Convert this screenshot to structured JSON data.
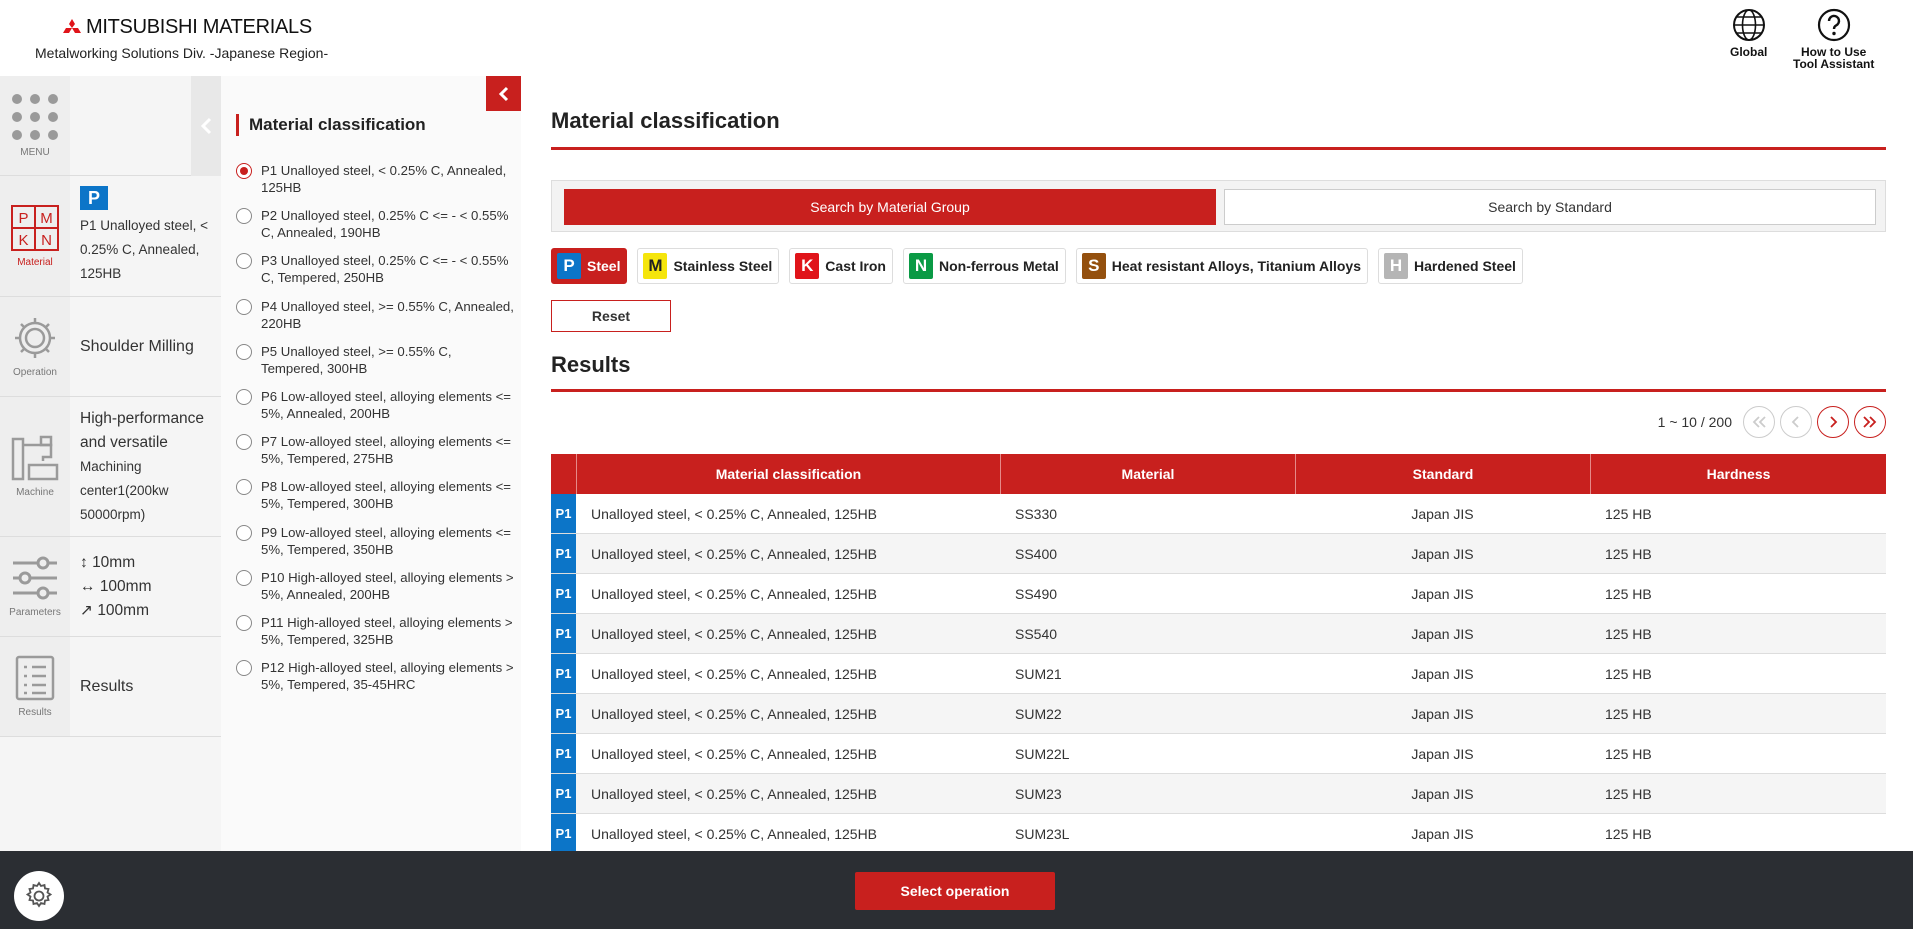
{
  "header": {
    "brand": "MITSUBISHI MATERIALS",
    "subtitle": "Metalworking Solutions Div. -Japanese Region-",
    "global_label": "Global",
    "howto_line1": "How to Use",
    "howto_line2": "Tool Assistant"
  },
  "nav": {
    "menu_label": "MENU",
    "material": {
      "icon_label": "Material",
      "badge": "P",
      "text": "P1 Unalloyed steel, < 0.25% C, Annealed, 125HB"
    },
    "operation": {
      "icon_label": "Operation",
      "text": "Shoulder Milling"
    },
    "machine": {
      "icon_label": "Machine",
      "title_line": "High-performance and versatile",
      "detail": "Machining center1(200kw 50000rpm)"
    },
    "parameters": {
      "icon_label": "Parameters",
      "p1": "10mm",
      "p2": "100mm",
      "p3": "100mm"
    },
    "results": {
      "icon_label": "Results",
      "text": "Results"
    }
  },
  "panel": {
    "title": "Material classification",
    "items": [
      {
        "label": "P1 Unalloyed steel, < 0.25% C, Annealed, 125HB",
        "checked": true
      },
      {
        "label": "P2 Unalloyed steel, 0.25% C <= - < 0.55% C, Annealed, 190HB",
        "checked": false
      },
      {
        "label": "P3 Unalloyed steel, 0.25% C <= - < 0.55% C, Tempered, 250HB",
        "checked": false
      },
      {
        "label": "P4 Unalloyed steel, >= 0.55% C, Annealed, 220HB",
        "checked": false
      },
      {
        "label": "P5 Unalloyed steel, >= 0.55% C, Tempered, 300HB",
        "checked": false
      },
      {
        "label": "P6 Low-alloyed steel, alloying elements <= 5%, Annealed, 200HB",
        "checked": false
      },
      {
        "label": "P7 Low-alloyed steel, alloying elements <= 5%, Tempered, 275HB",
        "checked": false
      },
      {
        "label": "P8 Low-alloyed steel, alloying elements <= 5%, Tempered, 300HB",
        "checked": false
      },
      {
        "label": "P9 Low-alloyed steel, alloying elements <= 5%, Tempered, 350HB",
        "checked": false
      },
      {
        "label": "P10 High-alloyed steel, alloying elements > 5%, Annealed, 200HB",
        "checked": false
      },
      {
        "label": "P11 High-alloyed steel, alloying elements > 5%, Tempered, 325HB",
        "checked": false
      },
      {
        "label": "P12 High-alloyed steel, alloying elements > 5%, Tempered, 35-45HRC",
        "checked": false
      }
    ]
  },
  "main": {
    "title": "Material classification",
    "search_group": "Search by Material Group",
    "search_standard": "Search by Standard",
    "groups": [
      {
        "badge": "P",
        "label": "Steel",
        "badge_bg": "#0c75c8",
        "badge_fg": "#ffffff",
        "active": true
      },
      {
        "badge": "M",
        "label": "Stainless Steel",
        "badge_bg": "#f5e50c",
        "badge_fg": "#222222",
        "active": false
      },
      {
        "badge": "K",
        "label": "Cast Iron",
        "badge_bg": "#e0141a",
        "badge_fg": "#ffffff",
        "active": false
      },
      {
        "badge": "N",
        "label": "Non-ferrous Metal",
        "badge_bg": "#0a9a45",
        "badge_fg": "#ffffff",
        "active": false
      },
      {
        "badge": "S",
        "label": "Heat resistant Alloys, Titanium Alloys",
        "badge_bg": "#94500e",
        "badge_fg": "#ffffff",
        "active": false
      },
      {
        "badge": "H",
        "label": "Hardened Steel",
        "badge_bg": "#b5b5b5",
        "badge_fg": "#ffffff",
        "active": false
      }
    ],
    "reset": "Reset",
    "results_title": "Results",
    "pager_count": "1 ~ 10 / 200",
    "columns": [
      "Material classification",
      "Material",
      "Standard",
      "Hardness"
    ],
    "rows": [
      {
        "tag": "P1",
        "classification": "Unalloyed steel, < 0.25% C, Annealed, 125HB",
        "material": "SS330",
        "standard": "Japan JIS",
        "hardness": "125 HB"
      },
      {
        "tag": "P1",
        "classification": "Unalloyed steel, < 0.25% C, Annealed, 125HB",
        "material": "SS400",
        "standard": "Japan JIS",
        "hardness": "125 HB"
      },
      {
        "tag": "P1",
        "classification": "Unalloyed steel, < 0.25% C, Annealed, 125HB",
        "material": "SS490",
        "standard": "Japan JIS",
        "hardness": "125 HB"
      },
      {
        "tag": "P1",
        "classification": "Unalloyed steel, < 0.25% C, Annealed, 125HB",
        "material": "SS540",
        "standard": "Japan JIS",
        "hardness": "125 HB"
      },
      {
        "tag": "P1",
        "classification": "Unalloyed steel, < 0.25% C, Annealed, 125HB",
        "material": "SUM21",
        "standard": "Japan JIS",
        "hardness": "125 HB"
      },
      {
        "tag": "P1",
        "classification": "Unalloyed steel, < 0.25% C, Annealed, 125HB",
        "material": "SUM22",
        "standard": "Japan JIS",
        "hardness": "125 HB"
      },
      {
        "tag": "P1",
        "classification": "Unalloyed steel, < 0.25% C, Annealed, 125HB",
        "material": "SUM22L",
        "standard": "Japan JIS",
        "hardness": "125 HB"
      },
      {
        "tag": "P1",
        "classification": "Unalloyed steel, < 0.25% C, Annealed, 125HB",
        "material": "SUM23",
        "standard": "Japan JIS",
        "hardness": "125 HB"
      },
      {
        "tag": "P1",
        "classification": "Unalloyed steel, < 0.25% C, Annealed, 125HB",
        "material": "SUM23L",
        "standard": "Japan JIS",
        "hardness": "125 HB"
      }
    ]
  },
  "footer": {
    "select_operation": "Select operation"
  },
  "colors": {
    "accent": "#c8201e",
    "steel_tag": "#0c75c8",
    "footer_bg": "#2b2e33"
  },
  "icons": {
    "logo": "three-diamonds-icon",
    "global": "globe-icon",
    "help": "question-circle-icon",
    "menu": "grid-dots-icon",
    "operation": "gear-icon",
    "machine": "machine-icon",
    "parameters": "sliders-icon",
    "results": "list-icon",
    "settings": "gear-icon"
  }
}
